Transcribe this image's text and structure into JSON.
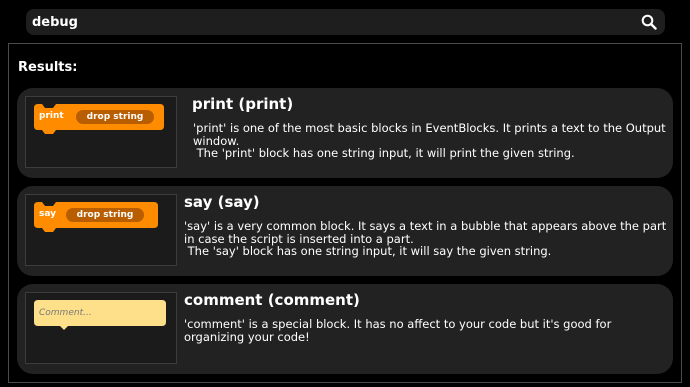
{
  "search": {
    "value": "debug",
    "icon": "search-icon"
  },
  "results_label": "Results:",
  "results": [
    {
      "title": "print (print)",
      "description_lines": [
        "'print' is one of the most basic blocks in EventBlocks. It prints a text to the Output",
        "window.",
        " The 'print' block has one string input, it will print the given string."
      ],
      "block": {
        "kind": "command",
        "label": "print",
        "input": "drop string",
        "color": "#ff8c00"
      }
    },
    {
      "title": "say (say)",
      "description_lines": [
        "'say' is a very common block. It says a text in a bubble that appears above the part",
        "in case the script is inserted into a part.",
        " The 'say' block has one string input, it will say the given string."
      ],
      "block": {
        "kind": "command",
        "label": "say",
        "input": "drop string",
        "color": "#ff8c00"
      }
    },
    {
      "title": "comment (comment)",
      "description_lines": [
        "'comment' is a special block. It has no affect to your code but it's good for",
        "organizing your code!"
      ],
      "block": {
        "kind": "comment",
        "placeholder": "Comment...",
        "color": "#ffe08a"
      }
    }
  ]
}
